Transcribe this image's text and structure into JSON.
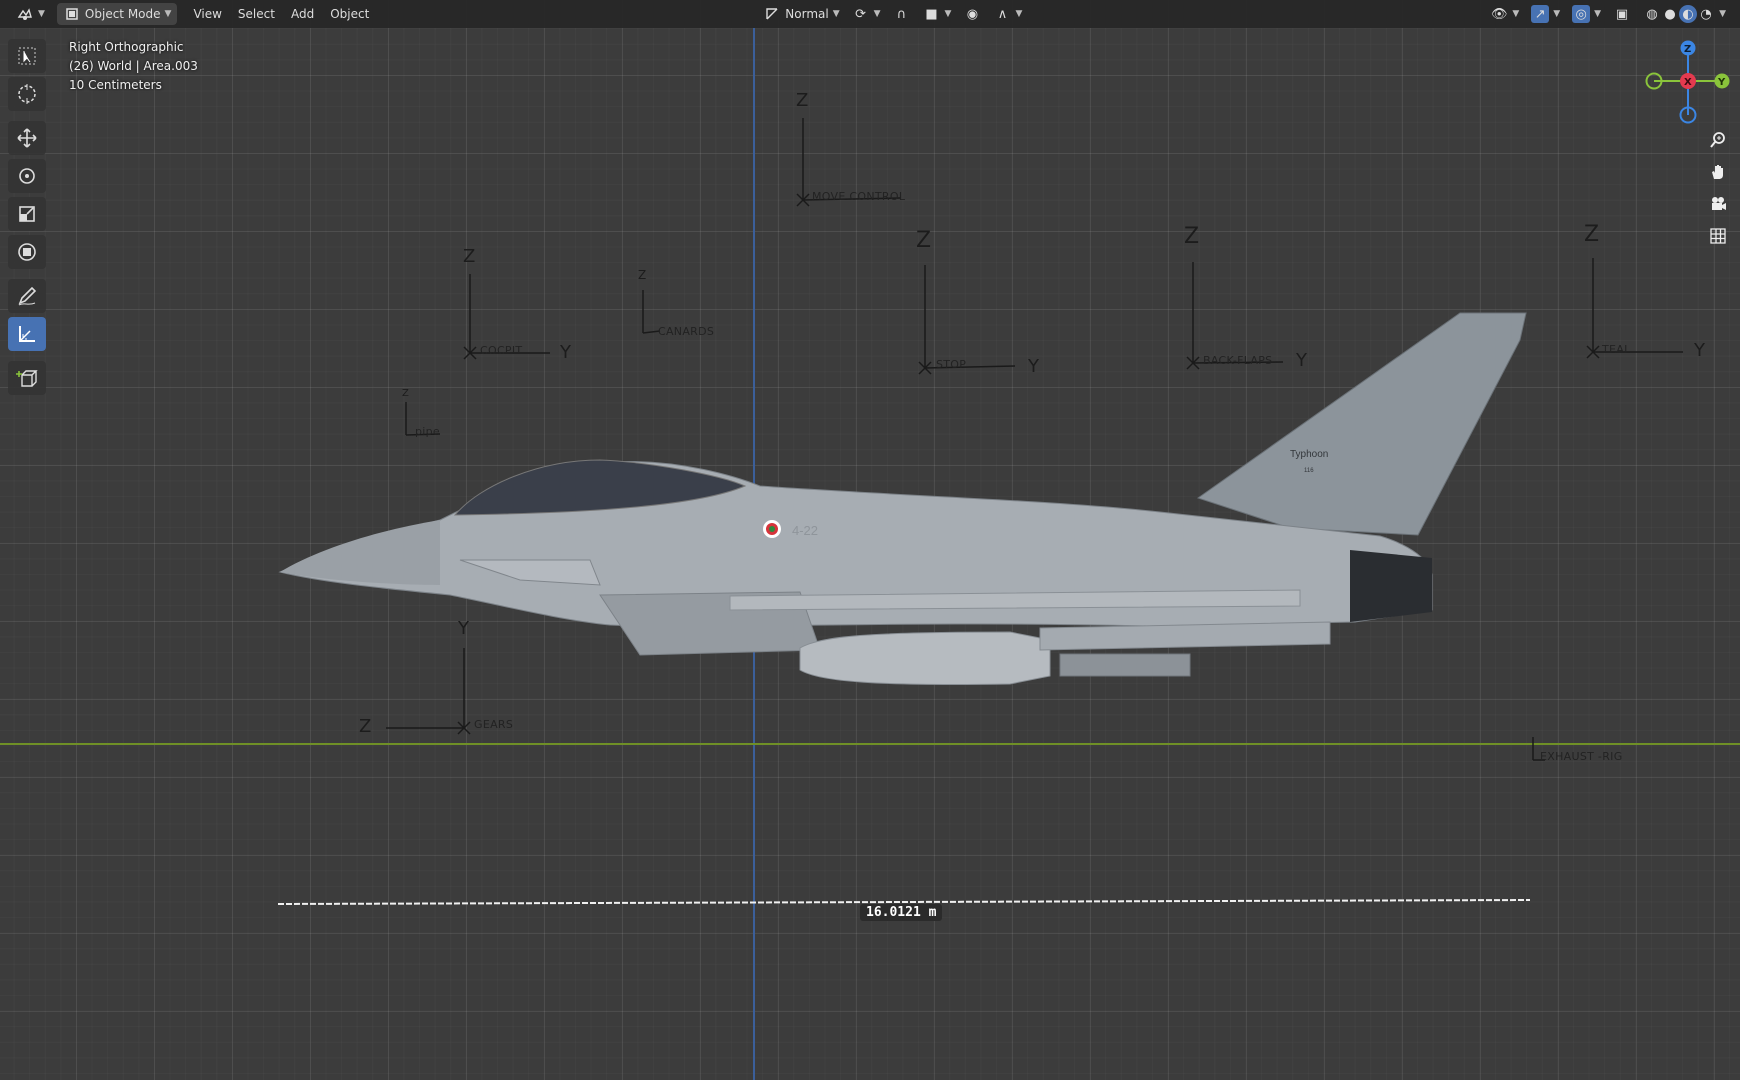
{
  "header": {
    "mode_label": "Object Mode",
    "menus": [
      "View",
      "Select",
      "Add",
      "Object"
    ],
    "transform_orientation": "Normal"
  },
  "overlay": {
    "view_name": "Right Orthographic",
    "collection": "(26) World | Area.003",
    "grid_scale": "10 Centimeters"
  },
  "gizmo": {
    "z": "Z",
    "x": "X",
    "y": "Y"
  },
  "empties": {
    "move_control": "MOVE CONTROL",
    "cockpit": "COCPIT",
    "canards": "CANARDS",
    "stop": "STOP",
    "back_flaps": "BACK-FLAPS",
    "teal": "TEAL",
    "pipe": "pipe",
    "gears": "GEARS",
    "exhaust": "EXHAUST -RIG",
    "axis_z": "Z",
    "axis_y": "Y"
  },
  "aircraft": {
    "tail_text": "Typhoon",
    "tail_number": "116",
    "side_code": "4-22"
  },
  "measurement": {
    "value": "16.0121 m"
  },
  "colors": {
    "accent": "#4772b3",
    "gizmo_x": "#e43a4f",
    "gizmo_y": "#8ac43b",
    "gizmo_z": "#3b86e4",
    "horizon_line": "#7a9a2a",
    "vertical_axis": "#3a5f9a"
  }
}
